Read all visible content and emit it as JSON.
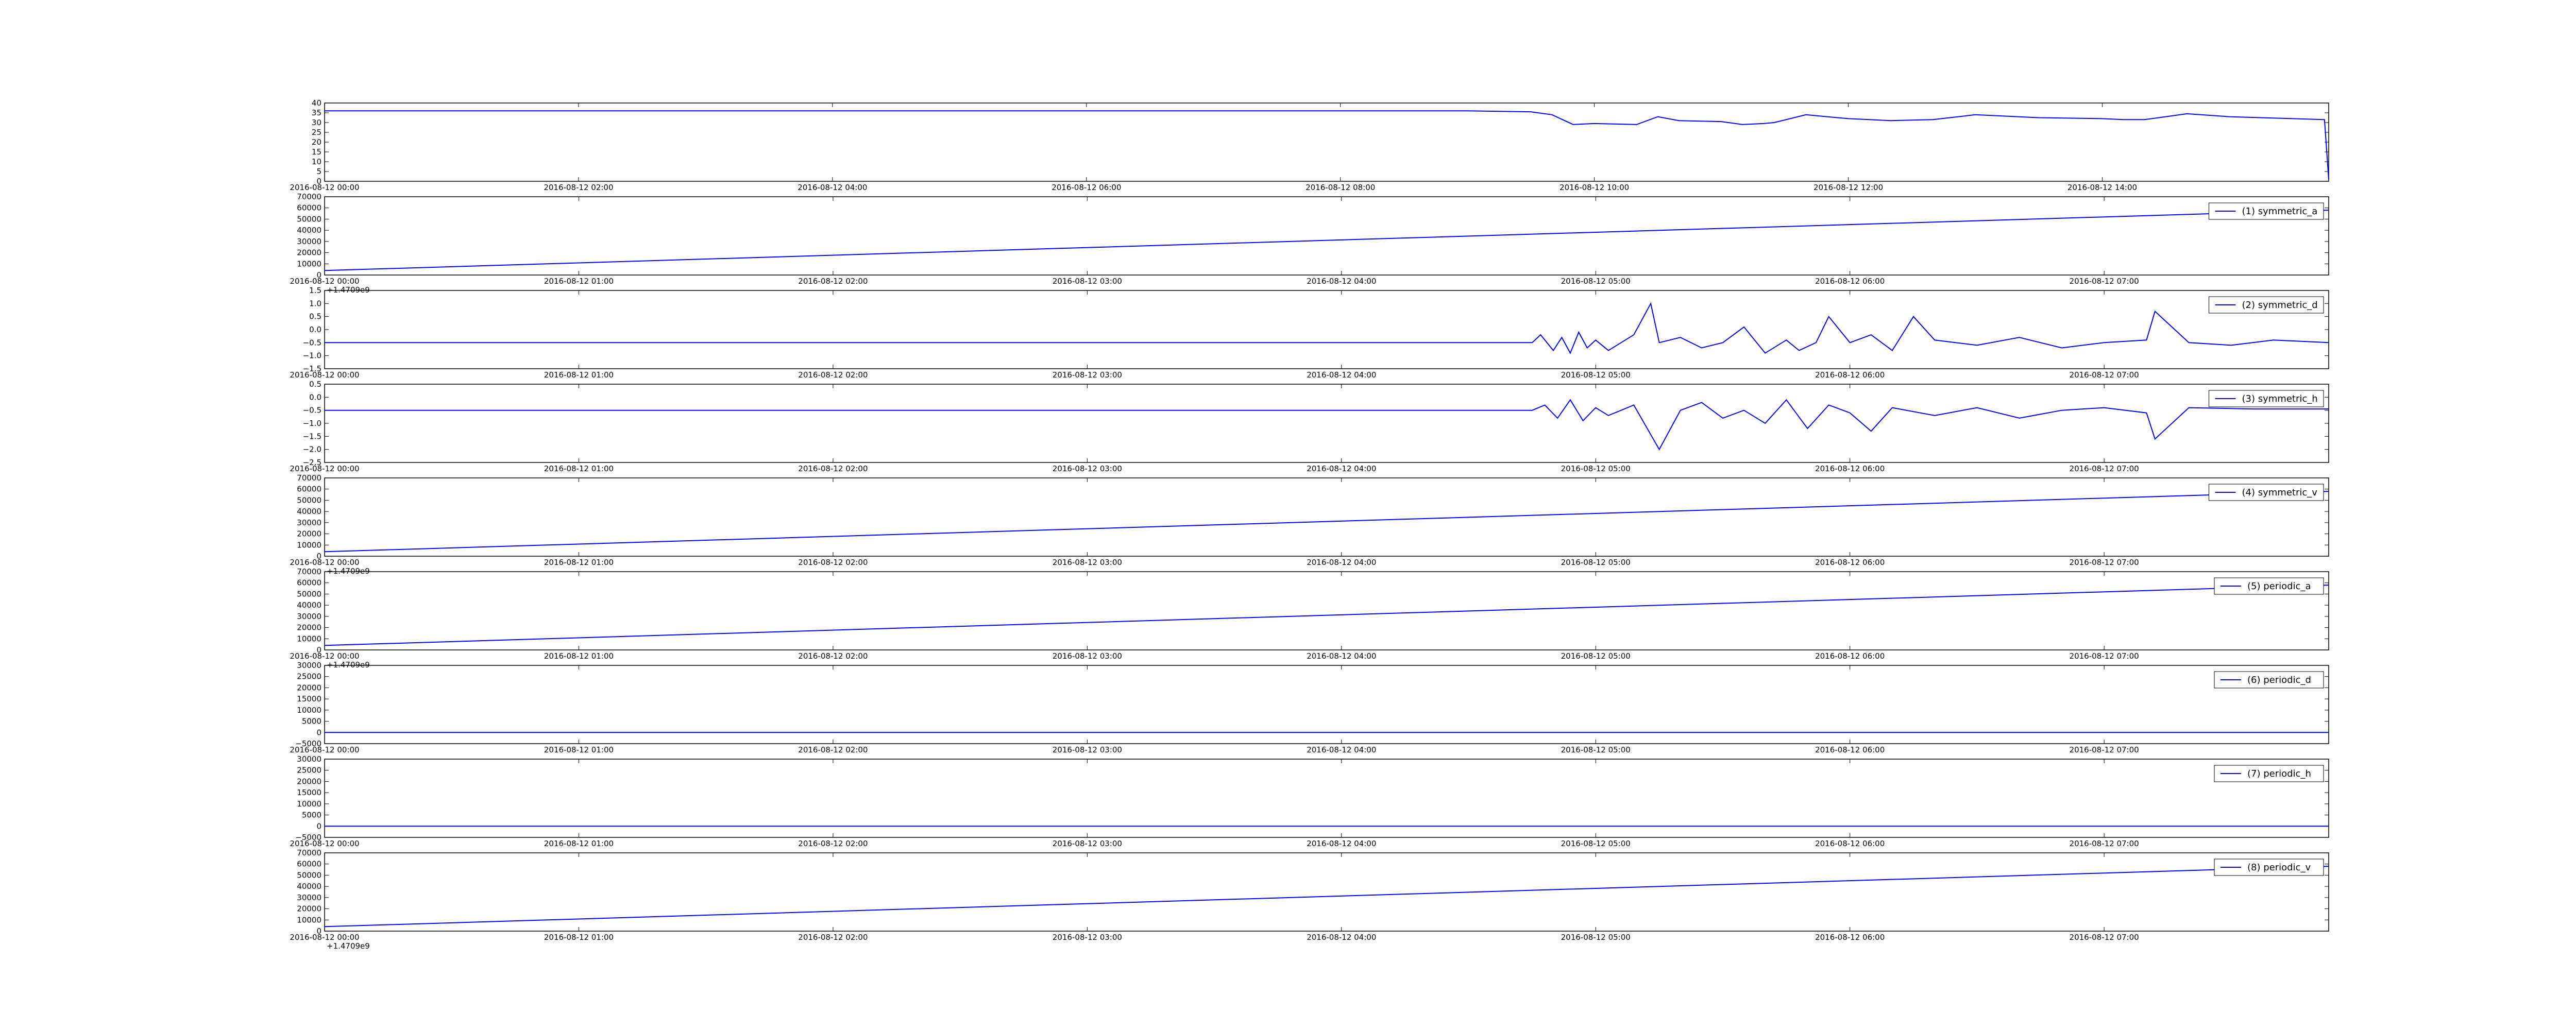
{
  "chart_data": [
    {
      "type": "line",
      "title": "",
      "xlabel": "",
      "ylabel": "",
      "xlim": [
        "2016-08-12 00:00",
        "2016-08-12 15:47"
      ],
      "ylim": [
        0,
        40
      ],
      "yticks": [
        0,
        5,
        10,
        15,
        20,
        25,
        30,
        35,
        40
      ],
      "yticklabels": [
        "0",
        "5",
        "10",
        "15",
        "20",
        "25",
        "30",
        "35",
        "40"
      ],
      "xticks": [
        "2016-08-12 00:00",
        "2016-08-12 02:00",
        "2016-08-12 04:00",
        "2016-08-12 06:00",
        "2016-08-12 08:00",
        "2016-08-12 10:00",
        "2016-08-12 12:00",
        "2016-08-12 14:00"
      ],
      "xticklabels": [
        "2016-08-12 00:00",
        "2016-08-12 02:00",
        "2016-08-12 04:00",
        "2016-08-12 06:00",
        "2016-08-12 08:00",
        "2016-08-12 10:00",
        "2016-08-12 12:00",
        "2016-08-12 14:00"
      ],
      "offset_text": "",
      "legend": null,
      "grid": false,
      "color": "#0000ff",
      "series": [
        {
          "x": [
            "2016-08-12 00:00",
            "2016-08-12 02:00",
            "2016-08-12 04:00",
            "2016-08-12 06:00",
            "2016-08-12 08:00",
            "2016-08-12 09:00",
            "2016-08-12 09:30",
            "2016-08-12 09:40",
            "2016-08-12 09:50",
            "2016-08-12 10:00",
            "2016-08-12 10:20",
            "2016-08-12 10:30",
            "2016-08-12 10:40",
            "2016-08-12 11:00",
            "2016-08-12 11:10",
            "2016-08-12 11:20",
            "2016-08-12 11:25",
            "2016-08-12 11:40",
            "2016-08-12 12:00",
            "2016-08-12 12:10",
            "2016-08-12 12:20",
            "2016-08-12 12:40",
            "2016-08-12 13:00",
            "2016-08-12 13:30",
            "2016-08-12 14:00",
            "2016-08-12 14:10",
            "2016-08-12 14:20",
            "2016-08-12 14:40",
            "2016-08-12 15:00",
            "2016-08-12 15:30",
            "2016-08-12 15:45",
            "2016-08-12 15:47"
          ],
          "values": [
            36,
            36,
            36,
            36,
            36,
            36,
            35.5,
            34,
            29,
            29.5,
            29,
            33,
            31,
            30.5,
            29,
            29.5,
            30,
            34,
            32,
            31.5,
            31,
            31.5,
            34,
            32.5,
            32,
            31.5,
            31.5,
            34.5,
            33,
            32,
            31.5,
            1
          ]
        }
      ]
    },
    {
      "type": "line",
      "title": "",
      "xlabel": "",
      "ylabel": "",
      "xlim": [
        "2016-08-12 00:00",
        "2016-08-12 07:53"
      ],
      "ylim": [
        0,
        70000
      ],
      "yticks": [
        0,
        10000,
        20000,
        30000,
        40000,
        50000,
        60000,
        70000
      ],
      "yticklabels": [
        "0",
        "10000",
        "20000",
        "30000",
        "40000",
        "50000",
        "60000",
        "70000"
      ],
      "xticks": [
        "2016-08-12 00:00",
        "2016-08-12 01:00",
        "2016-08-12 02:00",
        "2016-08-12 03:00",
        "2016-08-12 04:00",
        "2016-08-12 05:00",
        "2016-08-12 06:00",
        "2016-08-12 07:00"
      ],
      "xticklabels": [
        "2016-08-12 00:00",
        "2016-08-12 01:00",
        "2016-08-12 02:00",
        "2016-08-12 03:00",
        "2016-08-12 04:00",
        "2016-08-12 05:00",
        "2016-08-12 06:00",
        "2016-08-12 07:00"
      ],
      "offset_text": "+1.4709e9",
      "legend": "upper right",
      "grid": false,
      "color": "#0000ff",
      "series": [
        {
          "name": "(1) symmetric_a",
          "x": [
            "2016-08-12 00:00",
            "2016-08-12 07:53"
          ],
          "values": [
            4000,
            58000
          ]
        }
      ]
    },
    {
      "type": "line",
      "title": "",
      "xlabel": "",
      "ylabel": "",
      "xlim": [
        "2016-08-12 00:00",
        "2016-08-12 07:53"
      ],
      "ylim": [
        -1.5,
        1.5
      ],
      "yticks": [
        -1.5,
        -1.0,
        -0.5,
        0.0,
        0.5,
        1.0,
        1.5
      ],
      "yticklabels": [
        "−1.5",
        "−1.0",
        "−0.5",
        "0.0",
        "0.5",
        "1.0",
        "1.5"
      ],
      "xticks": [
        "2016-08-12 00:00",
        "2016-08-12 01:00",
        "2016-08-12 02:00",
        "2016-08-12 03:00",
        "2016-08-12 04:00",
        "2016-08-12 05:00",
        "2016-08-12 06:00",
        "2016-08-12 07:00"
      ],
      "xticklabels": [
        "2016-08-12 00:00",
        "2016-08-12 01:00",
        "2016-08-12 02:00",
        "2016-08-12 03:00",
        "2016-08-12 04:00",
        "2016-08-12 05:00",
        "2016-08-12 06:00",
        "2016-08-12 07:00"
      ],
      "offset_text": "",
      "legend": "upper right",
      "grid": false,
      "color": "#0000ff",
      "series": [
        {
          "name": "(2) symmetric_d",
          "x": [
            "2016-08-12 00:00",
            "2016-08-12 04:45",
            "2016-08-12 04:47",
            "2016-08-12 04:50",
            "2016-08-12 04:52",
            "2016-08-12 04:54",
            "2016-08-12 04:56",
            "2016-08-12 04:58",
            "2016-08-12 05:00",
            "2016-08-12 05:03",
            "2016-08-12 05:06",
            "2016-08-12 05:09",
            "2016-08-12 05:13",
            "2016-08-12 05:15",
            "2016-08-12 05:20",
            "2016-08-12 05:25",
            "2016-08-12 05:30",
            "2016-08-12 05:35",
            "2016-08-12 05:40",
            "2016-08-12 05:45",
            "2016-08-12 05:48",
            "2016-08-12 05:52",
            "2016-08-12 05:55",
            "2016-08-12 06:00",
            "2016-08-12 06:05",
            "2016-08-12 06:10",
            "2016-08-12 06:15",
            "2016-08-12 06:20",
            "2016-08-12 06:30",
            "2016-08-12 06:40",
            "2016-08-12 06:50",
            "2016-08-12 07:00",
            "2016-08-12 07:10",
            "2016-08-12 07:12",
            "2016-08-12 07:20",
            "2016-08-12 07:30",
            "2016-08-12 07:40",
            "2016-08-12 07:53"
          ],
          "values": [
            -0.5,
            -0.5,
            -0.2,
            -0.8,
            -0.3,
            -0.9,
            -0.1,
            -0.7,
            -0.4,
            -0.8,
            -0.5,
            -0.2,
            1.0,
            -0.5,
            -0.3,
            -0.7,
            -0.5,
            0.1,
            -0.9,
            -0.4,
            -0.8,
            -0.5,
            0.5,
            -0.5,
            -0.2,
            -0.8,
            0.5,
            -0.4,
            -0.6,
            -0.3,
            -0.7,
            -0.5,
            -0.4,
            0.7,
            -0.5,
            -0.6,
            -0.4,
            -0.5
          ]
        }
      ]
    },
    {
      "type": "line",
      "title": "",
      "xlabel": "",
      "ylabel": "",
      "xlim": [
        "2016-08-12 00:00",
        "2016-08-12 07:53"
      ],
      "ylim": [
        -2.5,
        0.5
      ],
      "yticks": [
        -2.5,
        -2.0,
        -1.5,
        -1.0,
        -0.5,
        0.0,
        0.5
      ],
      "yticklabels": [
        "−2.5",
        "−2.0",
        "−1.5",
        "−1.0",
        "−0.5",
        "0.0",
        "0.5"
      ],
      "xticks": [
        "2016-08-12 00:00",
        "2016-08-12 01:00",
        "2016-08-12 02:00",
        "2016-08-12 03:00",
        "2016-08-12 04:00",
        "2016-08-12 05:00",
        "2016-08-12 06:00",
        "2016-08-12 07:00"
      ],
      "xticklabels": [
        "2016-08-12 00:00",
        "2016-08-12 01:00",
        "2016-08-12 02:00",
        "2016-08-12 03:00",
        "2016-08-12 04:00",
        "2016-08-12 05:00",
        "2016-08-12 06:00",
        "2016-08-12 07:00"
      ],
      "offset_text": "",
      "legend": "upper right",
      "grid": false,
      "color": "#0000ff",
      "series": [
        {
          "name": "(3) symmetric_h",
          "x": [
            "2016-08-12 00:00",
            "2016-08-12 04:45",
            "2016-08-12 04:48",
            "2016-08-12 04:51",
            "2016-08-12 04:54",
            "2016-08-12 04:57",
            "2016-08-12 05:00",
            "2016-08-12 05:03",
            "2016-08-12 05:06",
            "2016-08-12 05:09",
            "2016-08-12 05:15",
            "2016-08-12 05:20",
            "2016-08-12 05:25",
            "2016-08-12 05:30",
            "2016-08-12 05:35",
            "2016-08-12 05:40",
            "2016-08-12 05:45",
            "2016-08-12 05:50",
            "2016-08-12 05:55",
            "2016-08-12 06:00",
            "2016-08-12 06:05",
            "2016-08-12 06:10",
            "2016-08-12 06:20",
            "2016-08-12 06:30",
            "2016-08-12 06:40",
            "2016-08-12 06:50",
            "2016-08-12 07:00",
            "2016-08-12 07:10",
            "2016-08-12 07:12",
            "2016-08-12 07:20",
            "2016-08-12 07:35",
            "2016-08-12 07:53"
          ],
          "values": [
            -0.5,
            -0.5,
            -0.3,
            -0.8,
            -0.1,
            -0.9,
            -0.4,
            -0.7,
            -0.5,
            -0.3,
            -2.0,
            -0.5,
            -0.2,
            -0.8,
            -0.5,
            -1.0,
            -0.1,
            -1.2,
            -0.3,
            -0.6,
            -1.3,
            -0.4,
            -0.7,
            -0.4,
            -0.8,
            -0.5,
            -0.4,
            -0.6,
            -1.6,
            -0.4,
            -0.45,
            -0.45
          ]
        }
      ]
    },
    {
      "type": "line",
      "title": "",
      "xlabel": "",
      "ylabel": "",
      "xlim": [
        "2016-08-12 00:00",
        "2016-08-12 07:53"
      ],
      "ylim": [
        0,
        70000
      ],
      "yticks": [
        0,
        10000,
        20000,
        30000,
        40000,
        50000,
        60000,
        70000
      ],
      "yticklabels": [
        "0",
        "10000",
        "20000",
        "30000",
        "40000",
        "50000",
        "60000",
        "70000"
      ],
      "xticks": [
        "2016-08-12 00:00",
        "2016-08-12 01:00",
        "2016-08-12 02:00",
        "2016-08-12 03:00",
        "2016-08-12 04:00",
        "2016-08-12 05:00",
        "2016-08-12 06:00",
        "2016-08-12 07:00"
      ],
      "xticklabels": [
        "2016-08-12 00:00",
        "2016-08-12 01:00",
        "2016-08-12 02:00",
        "2016-08-12 03:00",
        "2016-08-12 04:00",
        "2016-08-12 05:00",
        "2016-08-12 06:00",
        "2016-08-12 07:00"
      ],
      "offset_text": "+1.4709e9",
      "legend": "upper right",
      "grid": false,
      "color": "#0000ff",
      "series": [
        {
          "name": "(4) symmetric_v",
          "x": [
            "2016-08-12 00:00",
            "2016-08-12 07:53"
          ],
          "values": [
            4000,
            58000
          ]
        }
      ]
    },
    {
      "type": "line",
      "title": "",
      "xlabel": "",
      "ylabel": "",
      "xlim": [
        "2016-08-12 00:00",
        "2016-08-12 07:53"
      ],
      "ylim": [
        0,
        70000
      ],
      "yticks": [
        0,
        10000,
        20000,
        30000,
        40000,
        50000,
        60000,
        70000
      ],
      "yticklabels": [
        "0",
        "10000",
        "20000",
        "30000",
        "40000",
        "50000",
        "60000",
        "70000"
      ],
      "xticks": [
        "2016-08-12 00:00",
        "2016-08-12 01:00",
        "2016-08-12 02:00",
        "2016-08-12 03:00",
        "2016-08-12 04:00",
        "2016-08-12 05:00",
        "2016-08-12 06:00",
        "2016-08-12 07:00"
      ],
      "xticklabels": [
        "2016-08-12 00:00",
        "2016-08-12 01:00",
        "2016-08-12 02:00",
        "2016-08-12 03:00",
        "2016-08-12 04:00",
        "2016-08-12 05:00",
        "2016-08-12 06:00",
        "2016-08-12 07:00"
      ],
      "offset_text": "+1.4709e9",
      "legend": "upper right",
      "grid": false,
      "color": "#0000ff",
      "series": [
        {
          "name": "(5) periodic_a",
          "x": [
            "2016-08-12 00:00",
            "2016-08-12 07:53"
          ],
          "values": [
            4000,
            58000
          ]
        }
      ]
    },
    {
      "type": "line",
      "title": "",
      "xlabel": "",
      "ylabel": "",
      "xlim": [
        "2016-08-12 00:00",
        "2016-08-12 07:53"
      ],
      "ylim": [
        -5000,
        30000
      ],
      "yticks": [
        -5000,
        0,
        5000,
        10000,
        15000,
        20000,
        25000,
        30000
      ],
      "yticklabels": [
        "−5000",
        "0",
        "5000",
        "10000",
        "15000",
        "20000",
        "25000",
        "30000"
      ],
      "xticks": [
        "2016-08-12 00:00",
        "2016-08-12 01:00",
        "2016-08-12 02:00",
        "2016-08-12 03:00",
        "2016-08-12 04:00",
        "2016-08-12 05:00",
        "2016-08-12 06:00",
        "2016-08-12 07:00"
      ],
      "xticklabels": [
        "2016-08-12 00:00",
        "2016-08-12 01:00",
        "2016-08-12 02:00",
        "2016-08-12 03:00",
        "2016-08-12 04:00",
        "2016-08-12 05:00",
        "2016-08-12 06:00",
        "2016-08-12 07:00"
      ],
      "offset_text": "",
      "legend": "upper right",
      "grid": false,
      "color": "#0000ff",
      "series": [
        {
          "name": "(6) periodic_d",
          "x": [
            "2016-08-12 00:00",
            "2016-08-12 07:53"
          ],
          "values": [
            0,
            0
          ]
        }
      ]
    },
    {
      "type": "line",
      "title": "",
      "xlabel": "",
      "ylabel": "",
      "xlim": [
        "2016-08-12 00:00",
        "2016-08-12 07:53"
      ],
      "ylim": [
        -5000,
        30000
      ],
      "yticks": [
        -5000,
        0,
        5000,
        10000,
        15000,
        20000,
        25000,
        30000
      ],
      "yticklabels": [
        "−5000",
        "0",
        "5000",
        "10000",
        "15000",
        "20000",
        "25000",
        "30000"
      ],
      "xticks": [
        "2016-08-12 00:00",
        "2016-08-12 01:00",
        "2016-08-12 02:00",
        "2016-08-12 03:00",
        "2016-08-12 04:00",
        "2016-08-12 05:00",
        "2016-08-12 06:00",
        "2016-08-12 07:00"
      ],
      "xticklabels": [
        "2016-08-12 00:00",
        "2016-08-12 01:00",
        "2016-08-12 02:00",
        "2016-08-12 03:00",
        "2016-08-12 04:00",
        "2016-08-12 05:00",
        "2016-08-12 06:00",
        "2016-08-12 07:00"
      ],
      "offset_text": "",
      "legend": "upper right",
      "grid": false,
      "color": "#0000ff",
      "series": [
        {
          "name": "(7) periodic_h",
          "x": [
            "2016-08-12 00:00",
            "2016-08-12 07:53"
          ],
          "values": [
            0,
            0
          ]
        }
      ]
    },
    {
      "type": "line",
      "title": "",
      "xlabel": "",
      "ylabel": "",
      "xlim": [
        "2016-08-12 00:00",
        "2016-08-12 07:53"
      ],
      "ylim": [
        0,
        70000
      ],
      "yticks": [
        0,
        10000,
        20000,
        30000,
        40000,
        50000,
        60000,
        70000
      ],
      "yticklabels": [
        "0",
        "10000",
        "20000",
        "30000",
        "40000",
        "50000",
        "60000",
        "70000"
      ],
      "xticks": [
        "2016-08-12 00:00",
        "2016-08-12 01:00",
        "2016-08-12 02:00",
        "2016-08-12 03:00",
        "2016-08-12 04:00",
        "2016-08-12 05:00",
        "2016-08-12 06:00",
        "2016-08-12 07:00"
      ],
      "xticklabels": [
        "2016-08-12 00:00",
        "2016-08-12 01:00",
        "2016-08-12 02:00",
        "2016-08-12 03:00",
        "2016-08-12 04:00",
        "2016-08-12 05:00",
        "2016-08-12 06:00",
        "2016-08-12 07:00"
      ],
      "offset_text": "+1.4709e9",
      "legend": "upper right",
      "grid": false,
      "color": "#0000ff",
      "series": [
        {
          "name": "(8) periodic_v",
          "x": [
            "2016-08-12 00:00",
            "2016-08-12 07:53"
          ],
          "values": [
            4000,
            58000
          ]
        }
      ]
    }
  ]
}
